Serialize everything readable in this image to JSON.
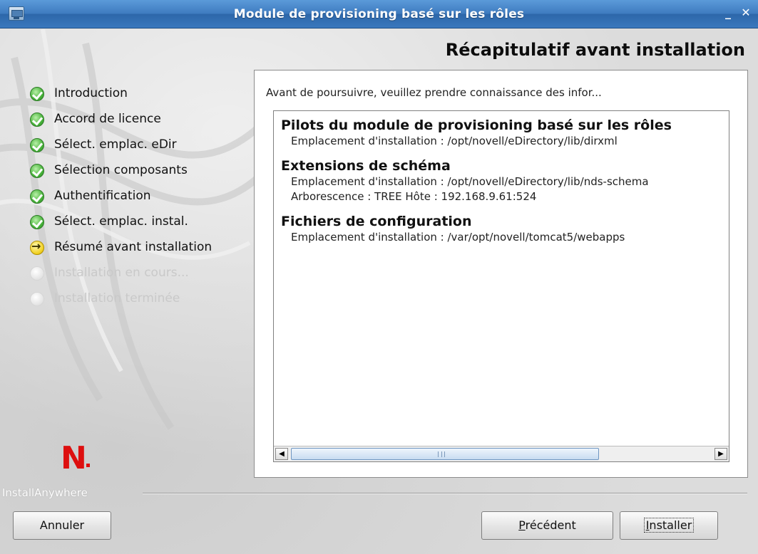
{
  "window": {
    "title": "Module de provisioning basé sur les rôles",
    "minimize_glyph": "_",
    "close_glyph": "✕"
  },
  "header": {
    "title": "Récapitulatif avant installation"
  },
  "steps": [
    {
      "label": "Introduction",
      "status": "done"
    },
    {
      "label": "Accord de licence",
      "status": "done"
    },
    {
      "label": "Sélect. emplac. eDir",
      "status": "done"
    },
    {
      "label": "Sélection composants",
      "status": "done"
    },
    {
      "label": "Authentification",
      "status": "done"
    },
    {
      "label": "Sélect. emplac. instal.",
      "status": "done"
    },
    {
      "label": "Résumé avant installation",
      "status": "current"
    },
    {
      "label": "Installation en cours...",
      "status": "pending"
    },
    {
      "label": "Installation terminée",
      "status": "pending"
    }
  ],
  "main": {
    "intro": "Avant de poursuivre, veuillez prendre connaissance des infor...",
    "sections": [
      {
        "title": "Pilots du module de provisioning basé sur les rôles",
        "lines": [
          "Emplacement d'installation : /opt/novell/eDirectory/lib/dirxml"
        ]
      },
      {
        "title": "Extensions de schéma",
        "lines": [
          "Emplacement d'installation : /opt/novell/eDirectory/lib/nds-schema",
          "Arborescence : TREE Hôte : 192.168.9.61:524"
        ]
      },
      {
        "title": "Fichiers de configuration",
        "lines": [
          "Emplacement d'installation : /var/opt/novell/tomcat5/webapps"
        ]
      }
    ],
    "scrollbar": {
      "left_arrow": "◀",
      "right_arrow": "▶",
      "position": 0.0
    }
  },
  "logo": {
    "text": "N",
    "name": "novell-logo"
  },
  "footer": {
    "brand": "InstallAnywhere",
    "cancel_label": "Annuler",
    "previous_label": "Précédent",
    "previous_mnemonic": "P",
    "previous_rest": "récédent",
    "install_label": "Installer",
    "install_mnemonic": "I",
    "install_rest": "nstaller"
  },
  "colors": {
    "titlebar": "#3f7cc0",
    "done": "#48b33a",
    "current": "#f2d225",
    "logo": "#dd0f0f"
  }
}
